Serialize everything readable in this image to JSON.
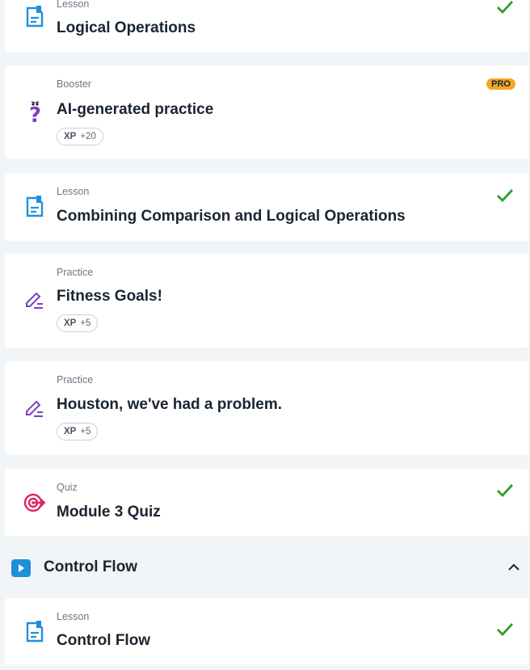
{
  "items": [
    {
      "type": "Lesson",
      "title": "Logical Operations",
      "icon": "lesson-doc-icon",
      "completed": true
    },
    {
      "type": "Booster",
      "title": "AI-generated practice",
      "icon": "question-mark-icon",
      "badge": "PRO",
      "xp_label": "XP",
      "xp_value": "+20"
    },
    {
      "type": "Lesson",
      "title": "Combining Comparison and Logical Operations",
      "icon": "lesson-doc-icon",
      "completed": true
    },
    {
      "type": "Practice",
      "title": "Fitness Goals!",
      "icon": "pencil-icon",
      "xp_label": "XP",
      "xp_value": "+5"
    },
    {
      "type": "Practice",
      "title": "Houston, we've had a problem.",
      "icon": "pencil-icon",
      "xp_label": "XP",
      "xp_value": "+5"
    },
    {
      "type": "Quiz",
      "title": "Module 3 Quiz",
      "icon": "target-icon",
      "completed": true
    }
  ],
  "section": {
    "title": "Control Flow",
    "expanded": true
  },
  "section_items": [
    {
      "type": "Lesson",
      "title": "Control Flow",
      "icon": "lesson-doc-icon",
      "completed": true
    }
  ],
  "colors": {
    "accent_blue": "#1e8fdb",
    "check_green": "#2ca02c",
    "practice_purple": "#7b3fc4",
    "quiz_pink": "#e0245e",
    "pro_badge": "#f5a623"
  }
}
